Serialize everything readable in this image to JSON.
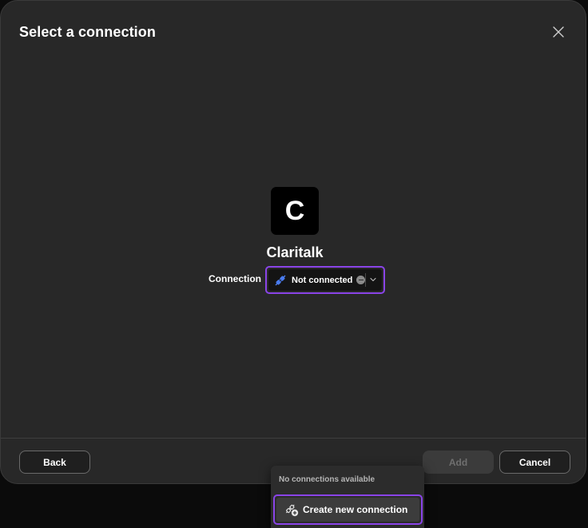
{
  "dialog": {
    "title": "Select a connection"
  },
  "app": {
    "initial": "C",
    "name": "Claritalk"
  },
  "connection": {
    "label": "Connection",
    "status": "Not connected"
  },
  "footer": {
    "back_label": "Back",
    "add_label": "Add",
    "cancel_label": "Cancel"
  },
  "dropdown": {
    "empty_text": "No connections available",
    "create_label": "Create new connection"
  },
  "icons": {
    "close": "close-icon",
    "plug": "plug-icon",
    "status": "status-dot-icon",
    "chevron": "chevron-down-icon",
    "create": "add-connection-icon"
  },
  "colors": {
    "accent": "#8a44e8",
    "plug_blue": "#4a7cf0",
    "dialog_bg": "#282828"
  }
}
